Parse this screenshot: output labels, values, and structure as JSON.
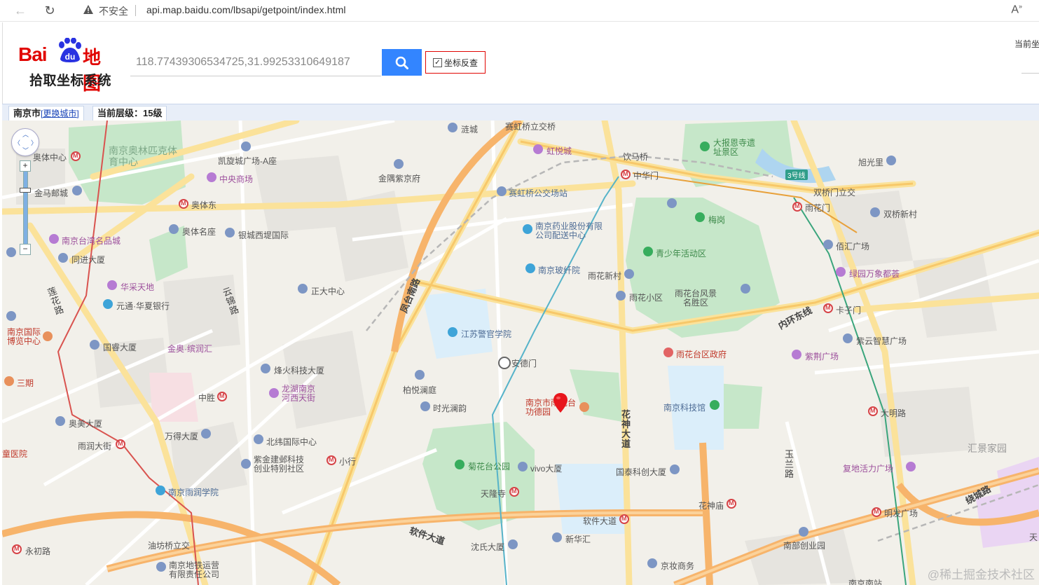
{
  "browser": {
    "security_text": "不安全",
    "url": "api.map.baidu.com/lbsapi/getpoint/index.html"
  },
  "header": {
    "logo_brand": "Bai",
    "logo_du": "du",
    "logo_ditu": "地图",
    "logo_subtitle": "拾取坐标系统",
    "search_value": "118.77439306534725,31.99253310649187",
    "reverse_label": "坐标反查",
    "reverse_checked": true,
    "current_point_label": "当前坐"
  },
  "infobar": {
    "city": "南京市",
    "change_city": "[更换城市]",
    "level": "当前层级：15级"
  },
  "colors": {
    "accent": "#3385ff",
    "brand_red": "#e10602",
    "metro_red": "#d64347"
  },
  "map": {
    "roads": [
      "凤台南路",
      "花神大道",
      "内环东线",
      "软件大道",
      "绕城路",
      "玉兰路",
      "莲花路",
      "云锦路"
    ],
    "labels": {
      "lianhu": "涟城",
      "saihongqiao_lijiao": "赛虹桥立交桥",
      "hongyue": "虹悦城",
      "yinmaqiao": "饮马桥",
      "dabaoen": "大报恩寺遗址景区",
      "xuguangli": "旭光里",
      "olympic_center": "南京奥林匹克体育中心",
      "olympic_center_stn": "奥体中心",
      "kaixuan": "凯旋城广场-A座",
      "zhongyang": "中央商场",
      "jinyu": "金隅紫京府",
      "zhonghuamen": "中华门",
      "line3": "3号线",
      "shuangqiaomen": "双桥门立交",
      "yuhuamen": "雨花门",
      "shuangqiao_xincun": "双桥新村",
      "jinmayou": "金马邮城",
      "aotidong": "奥体东",
      "saihongqiao_bus": "赛虹桥公交场站",
      "meigang": "梅岗",
      "aotimingsha": "奥体名座",
      "yincheng": "银城西堤国际",
      "pharma": "南京药业股份有限公司配送中心",
      "qingshaonian": "青少年活动区",
      "baihui": "佰汇广场",
      "taiwan": "南京台湾名品城",
      "tongjin": "同进大厦",
      "nanjing_fiber": "南京玻纤院",
      "yuhua_xincun": "雨花新村",
      "yuhuatai_scenic": "雨花台风景名胜区",
      "lvyuan": "绿园万象都荟",
      "huacai": "华采天地",
      "zhengda": "正大中心",
      "yuhua_xiaoqu": "雨花小区",
      "yuantong": "元通·华夏银行",
      "kazimen": "卡子门",
      "expo": "南京国际博览中心",
      "guorui": "国睿大厦",
      "jinao": "金奥·缤润汇",
      "jiangsu_police": "江苏警官学院",
      "yuhuatai_gov": "雨花台区政府",
      "ziyun": "紫云智慧广场",
      "sanshan": "三期",
      "fenghuo": "烽火科技大厦",
      "andemen": "安德门",
      "zijing": "紫荆广场",
      "baiyue": "柏悦澜庭",
      "longhu": "龙湖南京河西天街",
      "zhongsheng": "中胜",
      "shiguang": "时光澜韵",
      "gongde": "南京市雨花台功德园",
      "tech_museum": "南京科技馆",
      "daminglu": "大明路",
      "aomei": "奥美大厦",
      "wande": "万得大厦",
      "beiwei": "北纬国际中心",
      "huijing": "汇景家园",
      "yurun_street": "雨润大街",
      "zijin_park": "紫金建邺科技创业特别社区",
      "xiaoxing": "小行",
      "juhuatai": "菊花台公园",
      "vivo": "vivo大厦",
      "guotai": "国泰科创大厦",
      "fudi": "复地活力广场",
      "hospital": "童医院",
      "yurun_college": "南京雨润学院",
      "tianlongsi": "天隆寺",
      "huashenmiao": "花神庙",
      "minghuang": "明发广场",
      "ruanjian_stn": "软件大道",
      "yongchulu": "永初路",
      "youfangqiao": "油坊桥立交",
      "shenda": "沈氏大厦",
      "xinhuahui": "新华汇",
      "nanbu": "南部创业园",
      "metro_co": "南京地铁运营有限责任公司",
      "jingzhuang": "京妆商务",
      "nanjing_south": "南京南站",
      "tiaoshu": "天"
    }
  },
  "watermark": "@稀土掘金技术社区"
}
